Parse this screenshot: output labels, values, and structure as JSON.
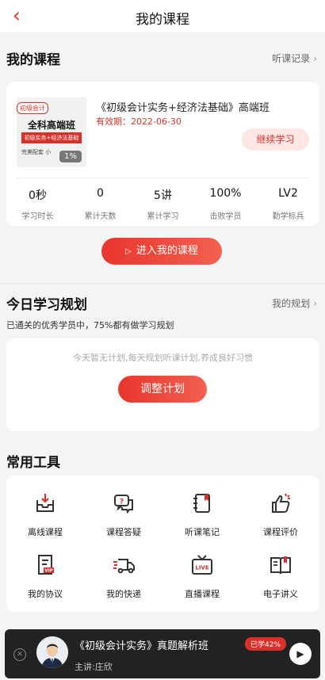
{
  "header": {
    "title": "我的课程",
    "back_icon": "chevron-left-icon"
  },
  "my_courses": {
    "heading": "我的课程",
    "history_link": "听课记录",
    "course": {
      "cover": {
        "tag": "初级会计",
        "main": "全科高端班",
        "band": "初级实务+经济法基础",
        "sub": "完美配套 小",
        "percent": "1%"
      },
      "name": "《初级会计实务+经济法基础》高端班",
      "expire": "有效期：2022-06-30",
      "continue_label": "继续学习"
    },
    "stats": [
      {
        "value": "0秒",
        "label": "学习时长"
      },
      {
        "value": "0",
        "label": "累计天数"
      },
      {
        "value": "5讲",
        "label": "累计学习"
      },
      {
        "value": "100%",
        "label": "击败学员"
      },
      {
        "value": "LV2",
        "label": "勤学标兵"
      }
    ],
    "enter_label": "进入我的课程"
  },
  "plan": {
    "heading": "今日学习规划",
    "link": "我的规划",
    "desc": "已通关的优秀学员中，75%都有做学习规划",
    "empty": "今天暂无计划,每天规划听课计划,养成良好习惯",
    "adjust_label": "调整计划"
  },
  "tools": {
    "heading": "常用工具",
    "items": [
      {
        "label": "离线课程",
        "icon": "download-tray-icon"
      },
      {
        "label": "课程答疑",
        "icon": "chat-question-icon"
      },
      {
        "label": "听课笔记",
        "icon": "notebook-icon"
      },
      {
        "label": "课程评价",
        "icon": "thumb-up-icon"
      },
      {
        "label": "我的协议",
        "icon": "vip-document-icon"
      },
      {
        "label": "我的快递",
        "icon": "delivery-truck-icon"
      },
      {
        "label": "直播课程",
        "icon": "live-tv-icon"
      },
      {
        "label": "电子讲义",
        "icon": "open-book-icon"
      }
    ]
  },
  "player": {
    "title": "《初级会计实务》真题解析班",
    "teacher": "主讲:庄欣",
    "progress": "已学42%"
  },
  "colors": {
    "accent": "#d8312c",
    "accent_light": "#fde6e4",
    "player_bg": "#222222"
  }
}
